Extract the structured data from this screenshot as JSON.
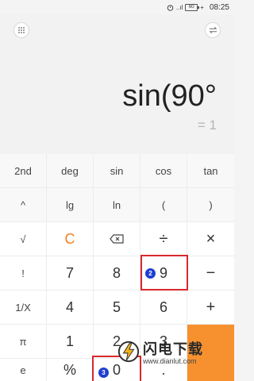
{
  "status_bar": {
    "time": "08:25",
    "signal_text": "..ıl",
    "battery_text": "60"
  },
  "display": {
    "menu_icon": "keypad-grid-icon",
    "switch_icon": "swap-arrows-icon",
    "expression": "sin(90°",
    "result": "= 1"
  },
  "keys": {
    "k_2nd": "2nd",
    "k_deg": "deg",
    "k_sin": "sin",
    "k_cos": "cos",
    "k_tan": "tan",
    "k_pow": "^",
    "k_lg": "lg",
    "k_ln": "ln",
    "k_lparen": "(",
    "k_rparen": ")",
    "k_sqrt": "√",
    "k_clear": "C",
    "k_backspace": "backspace-icon",
    "k_divide": "÷",
    "k_multiply": "×",
    "k_fact": "!",
    "k_7": "7",
    "k_8": "8",
    "k_9": "9",
    "k_minus": "−",
    "k_recip": "1/X",
    "k_4": "4",
    "k_5": "5",
    "k_6": "6",
    "k_plus": "+",
    "k_pi": "π",
    "k_1": "1",
    "k_2": "2",
    "k_3": "3",
    "k_e": "e",
    "k_percent": "%",
    "k_0": "0",
    "k_dot": "."
  },
  "annotations": {
    "step_2": "2",
    "step_3": "3"
  },
  "watermark": {
    "title": "闪电下载",
    "url": "www.dianlut.com"
  },
  "colors": {
    "accent_orange": "#f7912f",
    "clear_orange": "#f08020",
    "highlight_red": "#d9282c",
    "badge_blue": "#1f3fd1"
  }
}
